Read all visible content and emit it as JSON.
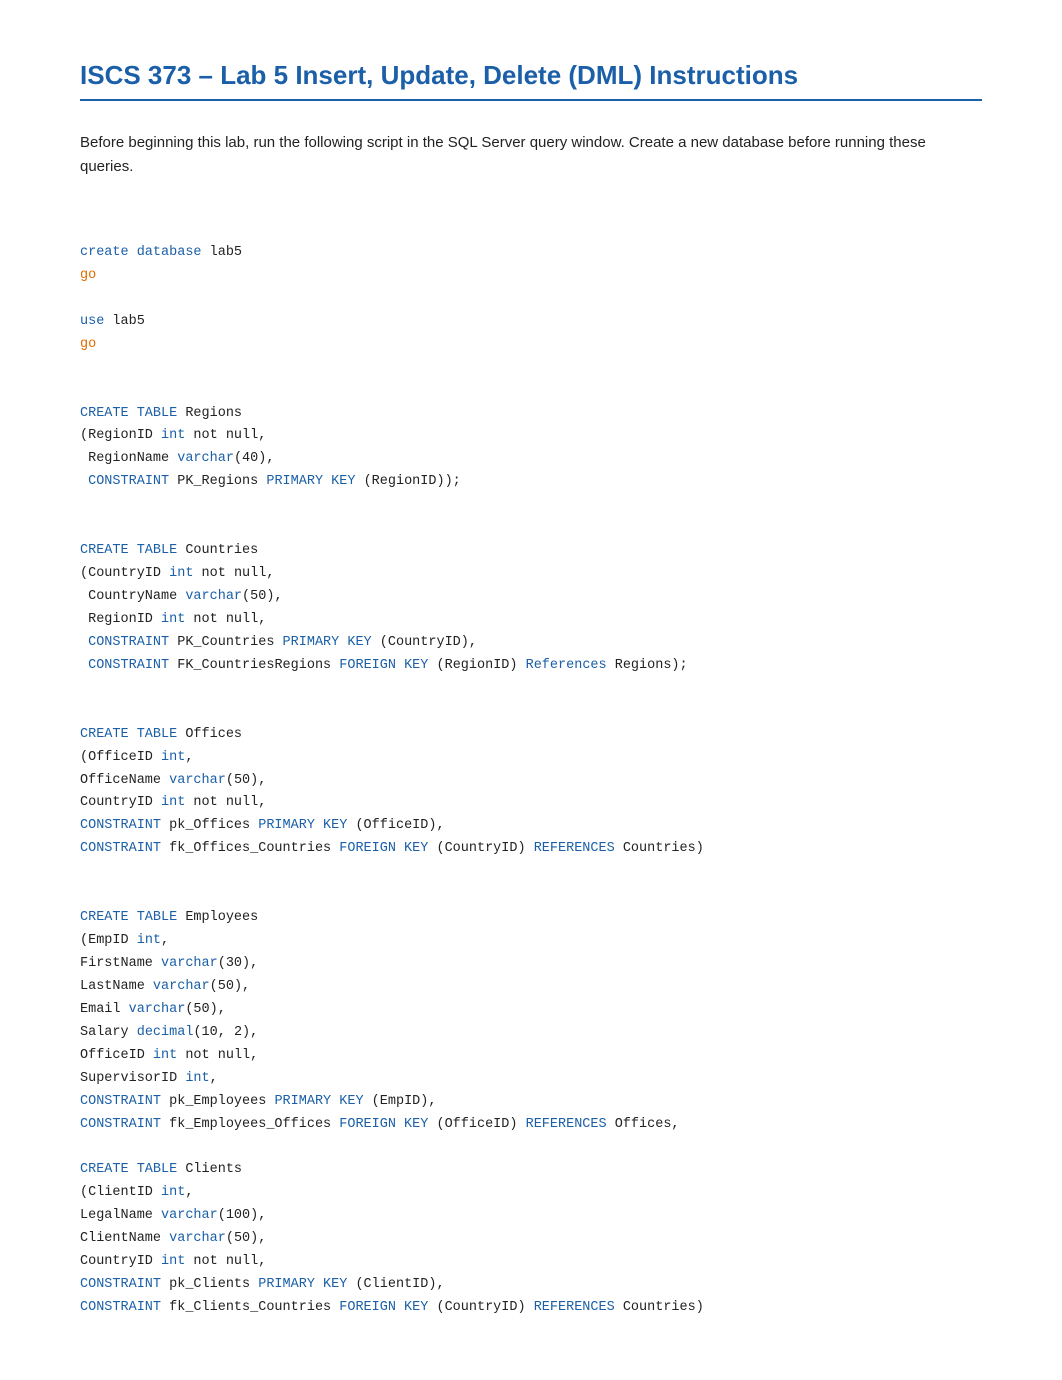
{
  "page": {
    "title": "ISCS 373 – Lab 5 Insert, Update, Delete (DML) Instructions",
    "intro": "Before beginning this lab, run the following script in the SQL Server query window.  Create a new database before running these queries."
  }
}
